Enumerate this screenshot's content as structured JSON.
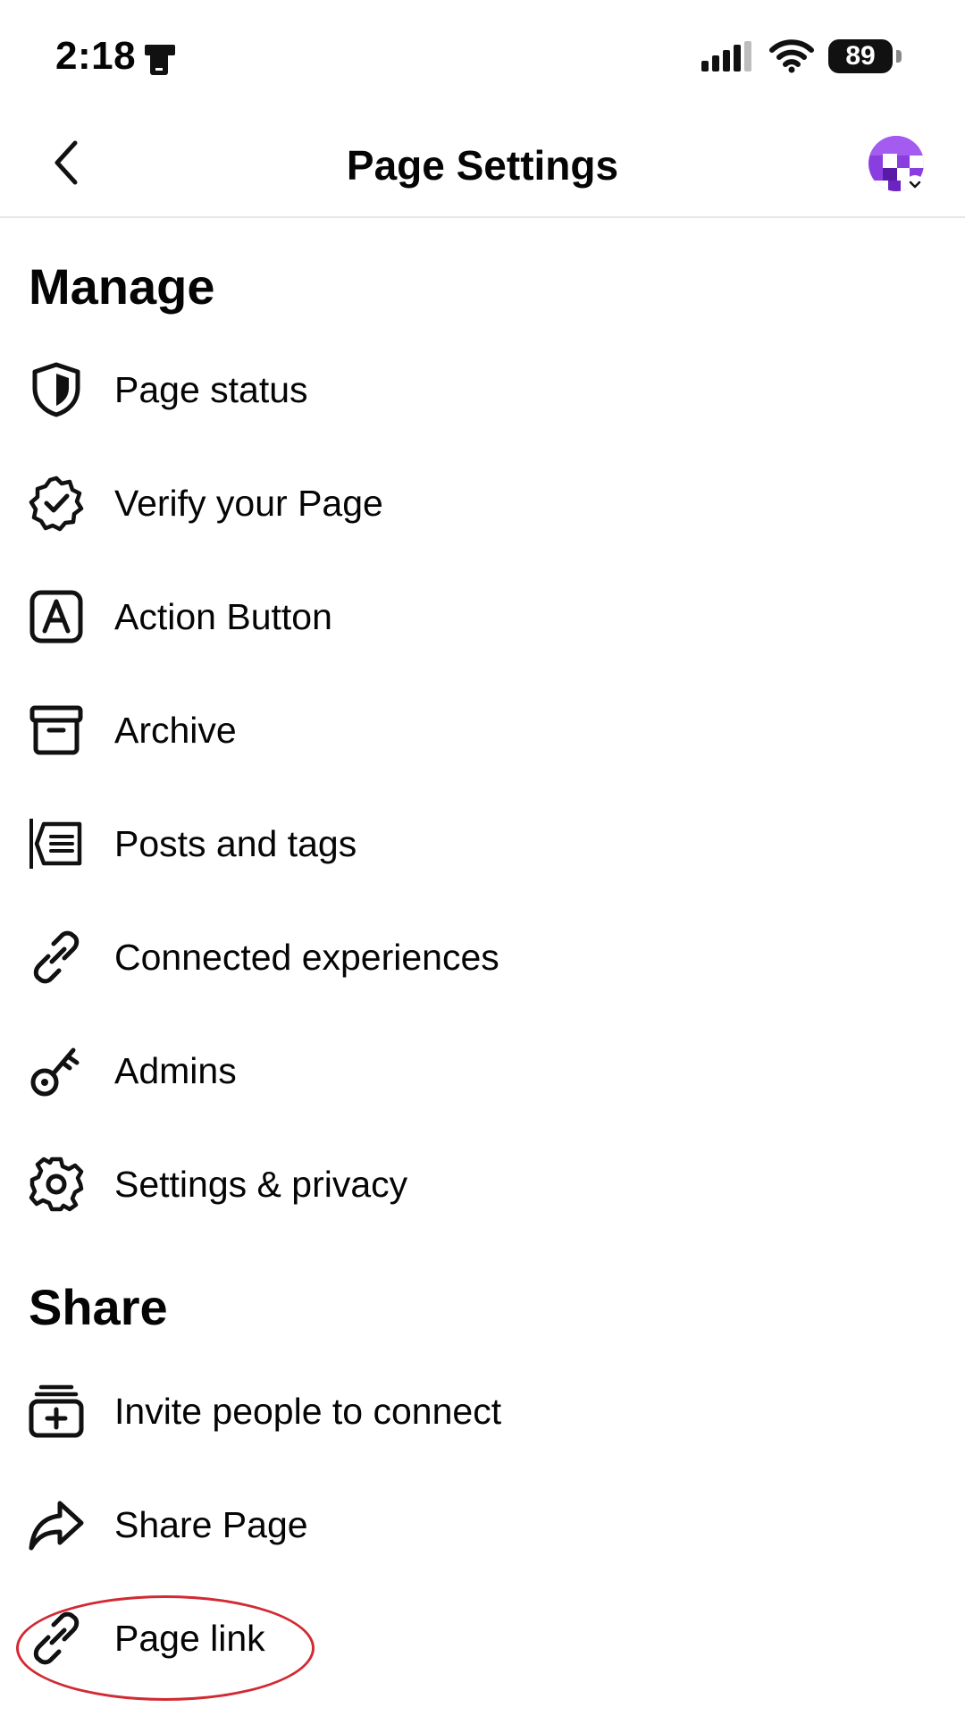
{
  "status_bar": {
    "time": "2:18",
    "battery": "89",
    "icons": [
      "focus-phone-icon",
      "signal-icon",
      "wifi-icon",
      "battery-icon"
    ]
  },
  "header": {
    "title": "Page Settings",
    "back_icon": "chevron-left-icon",
    "profile_icon": "page-avatar-icon"
  },
  "sections": {
    "manage": {
      "title": "Manage",
      "items": [
        {
          "label": "Page status",
          "icon": "shield-icon"
        },
        {
          "label": "Verify your Page",
          "icon": "verified-badge-icon"
        },
        {
          "label": "Action Button",
          "icon": "letter-a-icon"
        },
        {
          "label": "Archive",
          "icon": "archive-icon"
        },
        {
          "label": "Posts and tags",
          "icon": "posts-tags-icon"
        },
        {
          "label": "Connected experiences",
          "icon": "link-icon"
        },
        {
          "label": "Admins",
          "icon": "key-icon"
        },
        {
          "label": "Settings & privacy",
          "icon": "gear-icon"
        }
      ]
    },
    "share": {
      "title": "Share",
      "items": [
        {
          "label": "Invite people to connect",
          "icon": "invite-icon"
        },
        {
          "label": "Share Page",
          "icon": "share-arrow-icon"
        },
        {
          "label": "Page link",
          "icon": "link-icon"
        }
      ]
    }
  },
  "colors": {
    "text": "#050505",
    "divider": "#e4e6eb",
    "annotation": "#d12a33",
    "avatar_purple": "#7b2fd0"
  }
}
